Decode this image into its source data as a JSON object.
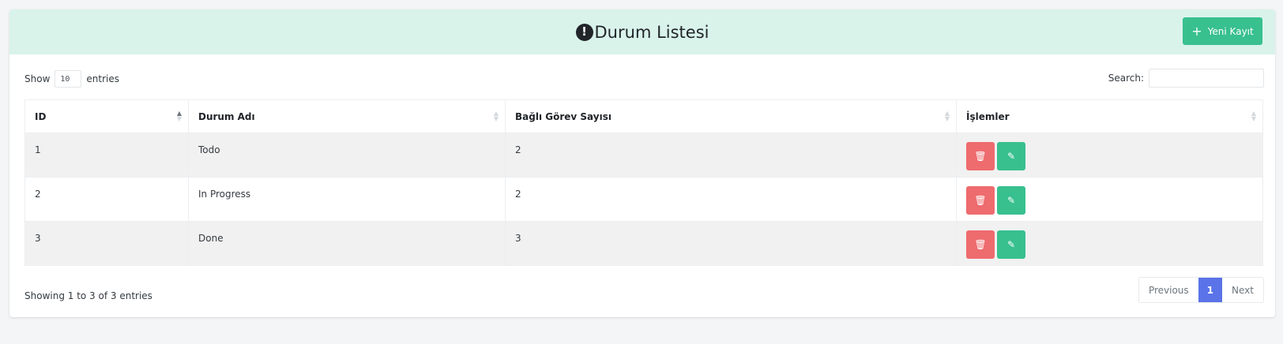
{
  "header": {
    "title": "Durum Listesi",
    "new_button_label": "Yeni Kayıt",
    "bg_color": "#d9f3eb"
  },
  "controls": {
    "show_label": "Show",
    "page_length": "10",
    "entries_label": "entries",
    "search_label": "Search:",
    "search_value": ""
  },
  "table": {
    "columns": [
      "ID",
      "Durum Adı",
      "Bağlı Görev Sayısı",
      "İşlemler"
    ],
    "sorted_column": "ID",
    "sort_direction": "asc",
    "rows": [
      {
        "id": "1",
        "name": "Todo",
        "count": "2"
      },
      {
        "id": "2",
        "name": "In Progress",
        "count": "2"
      },
      {
        "id": "3",
        "name": "Done",
        "count": "3"
      }
    ]
  },
  "footer": {
    "info": "Showing 1 to 3 of 3 entries",
    "pagination": {
      "previous": "Previous",
      "current": "1",
      "next": "Next"
    }
  },
  "colors": {
    "primary_green": "#38c08e",
    "danger_red": "#ee6b6e",
    "pager_active": "#5a73e8"
  },
  "icons": {
    "title_icon": "exclamation-circle-icon",
    "new_button_icon": "plus-icon",
    "delete_icon": "trash-icon",
    "edit_icon": "pencil-icon"
  }
}
